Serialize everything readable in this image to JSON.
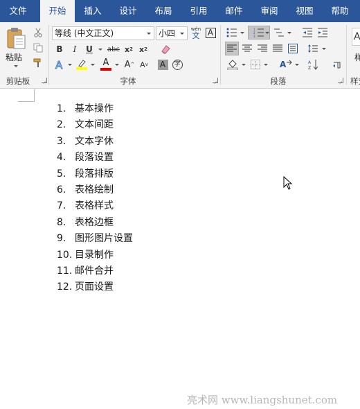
{
  "tabs": [
    "文件",
    "开始",
    "插入",
    "设计",
    "布局",
    "引用",
    "邮件",
    "审阅",
    "视图",
    "帮助"
  ],
  "active_tab": "开始",
  "clipboard": {
    "paste_label": "粘贴",
    "group_label": "剪贴板"
  },
  "font": {
    "name": "等线 (中文正文)",
    "size": "小四",
    "group_label": "字体",
    "wen_label": "wén",
    "wen_char": "文"
  },
  "paragraph": {
    "group_label": "段落"
  },
  "styles": {
    "group_label": "样式",
    "style_label": "样"
  },
  "colors": {
    "tab_bar": "#2b579a",
    "highlight": "#ffff00",
    "font_color": "#e00000",
    "ribbon": "#f3f3f3"
  },
  "document": {
    "list": [
      {
        "num": "1.",
        "text": "基本操作"
      },
      {
        "num": "2.",
        "text": "文本间距"
      },
      {
        "num": "3.",
        "text": "文本字休"
      },
      {
        "num": "4.",
        "text": "段落设置"
      },
      {
        "num": "5.",
        "text": "段落排版"
      },
      {
        "num": "6.",
        "text": "表格绘制"
      },
      {
        "num": "7.",
        "text": "表格样式"
      },
      {
        "num": "8.",
        "text": "表格边框"
      },
      {
        "num": "9.",
        "text": "图形图片设置"
      },
      {
        "num": "10.",
        "text": "目录制作"
      },
      {
        "num": "11.",
        "text": "邮件合并"
      },
      {
        "num": "12.",
        "text": "页面设置"
      }
    ]
  },
  "watermark": "亮术网 www.liangshunet.com"
}
